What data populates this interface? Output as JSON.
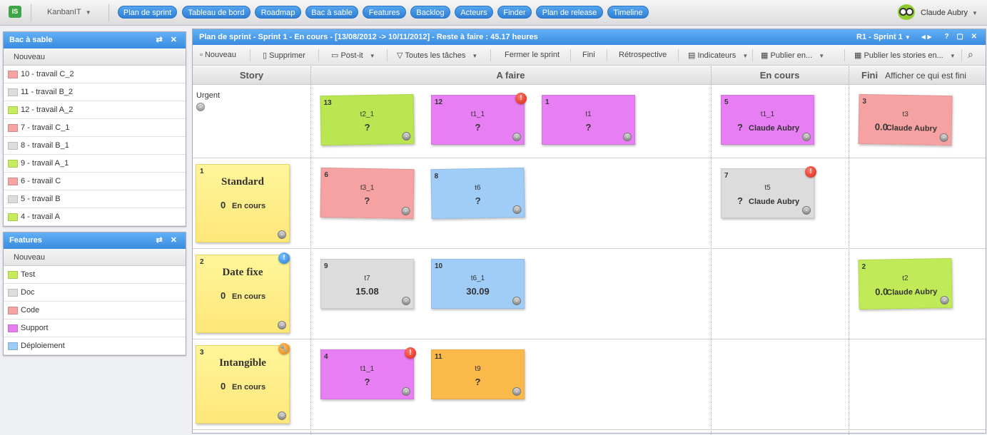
{
  "app": {
    "logo": "IS",
    "product": "KanbanIT",
    "user": "Claude Aubry"
  },
  "nav": [
    "Plan de sprint",
    "Tableau de bord",
    "Roadmap",
    "Bac à sable",
    "Features",
    "Backlog",
    "Acteurs",
    "Finder",
    "Plan de release",
    "Timeline"
  ],
  "sandbox": {
    "title": "Bac à sable",
    "controls": "⇄ ✕",
    "new_label": "Nouveau",
    "items": [
      {
        "label": "10 - travail C_2",
        "color": "#f5a3a3"
      },
      {
        "label": "11 - travail B_2",
        "color": "#dddddd"
      },
      {
        "label": "12 - travail A_2",
        "color": "#c6ec5c"
      },
      {
        "label": "7 - travail C_1",
        "color": "#f5a3a3"
      },
      {
        "label": "8 - travail B_1",
        "color": "#dddddd"
      },
      {
        "label": "9 - travail A_1",
        "color": "#c6ec5c"
      },
      {
        "label": "6 - travail C",
        "color": "#f5a3a3"
      },
      {
        "label": "5 - travail B",
        "color": "#dddddd"
      },
      {
        "label": "4 - travail A",
        "color": "#c6ec5c"
      }
    ]
  },
  "features": {
    "title": "Features",
    "controls": "⇄ ✕",
    "new_label": "Nouveau",
    "items": [
      {
        "label": "Test",
        "color": "#c6ec5c"
      },
      {
        "label": "Doc",
        "color": "#dddddd"
      },
      {
        "label": "Code",
        "color": "#f5a3a3"
      },
      {
        "label": "Support",
        "color": "#e77ef0"
      },
      {
        "label": "Déploiement",
        "color": "#9ccbf7"
      }
    ]
  },
  "board": {
    "title": "Plan de sprint - Sprint 1 - En cours - [13/08/2012 -> 10/11/2012] - Reste à faire : 45.17 heures",
    "sprint": "R1 - Sprint 1",
    "controls": "? ▢ ✕",
    "toolbar": [
      "Nouveau",
      "Supprimer",
      "Post-it",
      "Toutes les tâches",
      "Fermer le sprint",
      "Fini",
      "Rétrospective",
      "Indicateurs",
      "Publier en...",
      "Publier les stories en..."
    ],
    "columns": {
      "story": "Story",
      "todo": "A faire",
      "doing": "En cours",
      "done": "Fini",
      "done_link": "Afficher ce qui est fini"
    },
    "urgent_label": "Urgent",
    "stories": [
      {
        "num": "1",
        "title": "Standard",
        "points": "0",
        "status": "En cours"
      },
      {
        "num": "2",
        "title": "Date fixe",
        "points": "0",
        "status": "En cours"
      },
      {
        "num": "3",
        "title": "Intangible",
        "points": "0",
        "status": "En cours"
      }
    ],
    "cards": [
      {
        "num": "13",
        "title": "t2_1",
        "value": "?",
        "user": "",
        "color": "#b9e651"
      },
      {
        "num": "12",
        "title": "t1_1",
        "value": "?",
        "user": "",
        "color": "#e87ef3"
      },
      {
        "num": "1",
        "title": "t1",
        "value": "?",
        "user": "",
        "color": "#e87ef3"
      },
      {
        "num": "5",
        "title": "t1_1",
        "value": "?",
        "user": "Claude Aubry",
        "color": "#e87ef3"
      },
      {
        "num": "3",
        "title": "t3",
        "value": "0.0",
        "user": "Claude Aubry",
        "color": "#f6a2a2"
      },
      {
        "num": "6",
        "title": "t3_1",
        "value": "?",
        "user": "",
        "color": "#f6a2a2"
      },
      {
        "num": "8",
        "title": "t6",
        "value": "?",
        "user": "",
        "color": "#9fcdf7"
      },
      {
        "num": "7",
        "title": "t5",
        "value": "?",
        "user": "Claude Aubry",
        "color": "#dcdcdc"
      },
      {
        "num": "9",
        "title": "t7",
        "value": "15.08",
        "user": "",
        "color": "#dcdcdc"
      },
      {
        "num": "10",
        "title": "t6_1",
        "value": "30.09",
        "user": "",
        "color": "#9fcdf7"
      },
      {
        "num": "2",
        "title": "t2",
        "value": "0.0",
        "user": "Claude Aubry",
        "color": "#c0ea58"
      },
      {
        "num": "4",
        "title": "t1_1",
        "value": "?",
        "user": "",
        "color": "#e87ef3"
      },
      {
        "num": "11",
        "title": "t9",
        "value": "?",
        "user": "",
        "color": "#fbb94a"
      }
    ],
    "badges": {
      "alert": "!",
      "info": "!",
      "tool": "🔧"
    }
  }
}
